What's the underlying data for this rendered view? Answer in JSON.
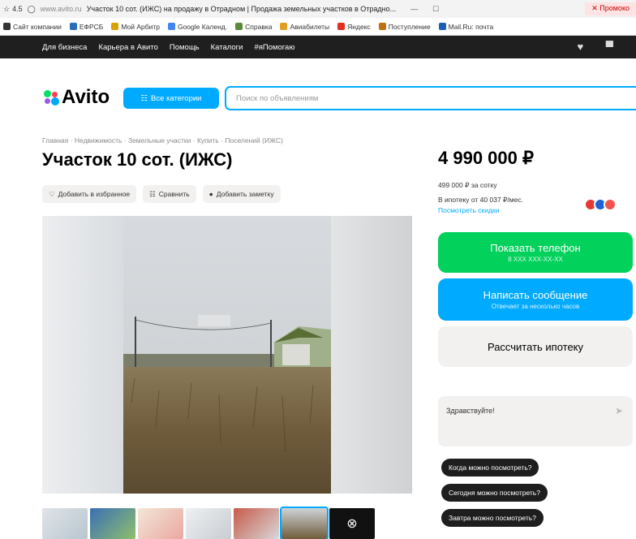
{
  "browser": {
    "zoom": "4.5",
    "url": "www.avito.ru",
    "tab_title": "Участок 10 сот. (ИЖС) на продажу в Отрадном | Продажа земельных участков в Отрадно...",
    "promo": "Промоко",
    "bookmarks": [
      "Сайт компании",
      "ЕФРСБ",
      "Мой Арбитр",
      "Google Календ.",
      "Справка",
      "Авиабилеты",
      "Яндекс",
      "Поступление",
      "Mail.Ru: почта"
    ]
  },
  "sitenav": {
    "items": [
      "Для бизнеса",
      "Карьера в Авито",
      "Помощь",
      "Каталоги",
      "#яПомогаю"
    ]
  },
  "header": {
    "logo_text": "Avito",
    "categories_button": "Все категории",
    "search_placeholder": "Поиск по объявлениям"
  },
  "breadcrumbs": "Главная · Недвижимость · Земельные участки · Купить · Поселений (ИЖС)",
  "title": "Участок 10 сот. (ИЖС)",
  "actions": {
    "favorite": "Добавить в избранное",
    "compare": "Сравнить",
    "note": "Добавить заметку"
  },
  "price": {
    "value": "4 990 000 ₽",
    "per_are": "499 000 ₽ за сотку",
    "mortgage": "В ипотеку от 40 037 ₽/мес.",
    "mortgage_link": "Посмотреть скидки"
  },
  "buttons": {
    "show_phone": "Показать телефон",
    "phone_masked": "8 XXX XXX-XX-XX",
    "write_message": "Написать сообщение",
    "message_sub": "Отвечает за несколько часов",
    "calc_mortgage": "Рассчитать ипотеку"
  },
  "chat": {
    "greeting": "Здравствуйте!",
    "quick_questions": [
      "Когда можно посмотреть?",
      "Сегодня можно посмотреть?",
      "Завтра можно посмотреть?"
    ]
  },
  "colors": {
    "brand_blue": "#00aaff",
    "phone_green": "#02d15c",
    "nav_dark": "#1f1f1f"
  }
}
